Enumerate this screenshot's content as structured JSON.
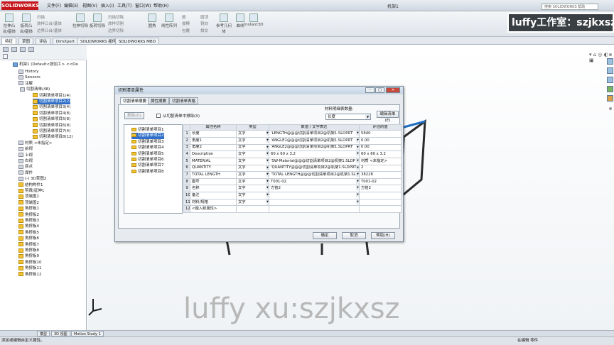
{
  "app": {
    "logo": "SOLIDWORKS",
    "doc_title": "机架1",
    "search_placeholder": "搜索 SOLIDWORKS 帮助"
  },
  "menu": [
    "文件(F)",
    "编辑(E)",
    "视图(V)",
    "插入(I)",
    "工具(T)",
    "窗口(W)",
    "帮助(H)"
  ],
  "ribbon": {
    "buttons": [
      {
        "label": "拉伸凸台/基体"
      },
      {
        "label": "旋转凸台/基体"
      },
      {
        "label": "拉伸切除"
      },
      {
        "label": "旋转切除"
      },
      {
        "label": "圆角"
      },
      {
        "label": "线性阵列"
      },
      {
        "label": "拔模"
      },
      {
        "label": "包覆"
      },
      {
        "label": "参考几何体"
      },
      {
        "label": "曲线"
      },
      {
        "label": "Instant3D"
      }
    ],
    "small_items": [
      "扫描",
      "放样凸台/基体",
      "边界凸台/基体",
      "扫描切除",
      "放样切割",
      "边界切除",
      "筋",
      "圆顶",
      "镜向",
      "相交"
    ]
  },
  "brand_banner": "luffy工作室：szjkxsz",
  "tabs": [
    "特征",
    "草图",
    "评估",
    "DimXpert",
    "SOLIDWORKS 插件",
    "SOLIDWORKS MBD"
  ],
  "tree": {
    "root": "机架1 (Default<按加工> <<De",
    "items": [
      {
        "label": "History",
        "icon": "gray"
      },
      {
        "label": "Sensors",
        "icon": "gray"
      },
      {
        "label": "注解",
        "icon": "gray"
      },
      {
        "label": "切割清单(48)",
        "icon": "gray"
      },
      {
        "label": "切割清单项目1(4)",
        "icon": "yellow"
      },
      {
        "label": "切割清单项目2(2)",
        "icon": "yellow",
        "selected": true
      },
      {
        "label": "切割清单项目3(4)",
        "icon": "yellow"
      },
      {
        "label": "切割清单项目4(8)",
        "icon": "yellow"
      },
      {
        "label": "切割清单项目5(8)",
        "icon": "yellow"
      },
      {
        "label": "切割清单项目6(8)",
        "icon": "yellow"
      },
      {
        "label": "切割清单项目7(4)",
        "icon": "yellow"
      },
      {
        "label": "切割清单项目8(12)",
        "icon": "yellow"
      },
      {
        "label": "材质 <未指定>",
        "icon": "gray"
      },
      {
        "label": "前视",
        "icon": "gray"
      },
      {
        "label": "上视",
        "icon": "gray"
      },
      {
        "label": "右视",
        "icon": "gray"
      },
      {
        "label": "原点",
        "icon": "gray"
      },
      {
        "label": "焊件",
        "icon": "gray"
      },
      {
        "label": "(-) 3D草图2",
        "icon": "gray"
      },
      {
        "label": "结构构件1",
        "icon": "yellow"
      },
      {
        "label": "剪裁/延伸1",
        "icon": "yellow"
      },
      {
        "label": "顶端盖1",
        "icon": "yellow"
      },
      {
        "label": "顶端盖2",
        "icon": "yellow"
      },
      {
        "label": "角撑板1",
        "icon": "yellow"
      },
      {
        "label": "角撑板2",
        "icon": "yellow"
      },
      {
        "label": "角撑板3",
        "icon": "yellow"
      },
      {
        "label": "角撑板4",
        "icon": "yellow"
      },
      {
        "label": "角撑板5",
        "icon": "yellow"
      },
      {
        "label": "角撑板6",
        "icon": "yellow"
      },
      {
        "label": "角撑板7",
        "icon": "yellow"
      },
      {
        "label": "角撑板8",
        "icon": "yellow"
      },
      {
        "label": "角撑板9",
        "icon": "yellow"
      },
      {
        "label": "角撑板10",
        "icon": "yellow"
      },
      {
        "label": "角撑板11",
        "icon": "yellow"
      },
      {
        "label": "角撑板12",
        "icon": "yellow"
      }
    ]
  },
  "dialog": {
    "title": "切割清单属性",
    "tabs": [
      "切割清单摘要",
      "属性摘要",
      "切割清单表格"
    ],
    "delete_button": "删除(D)",
    "exclude_checkbox_label": "从切割清单中排除(X)",
    "length_label": "材料明细表数量:",
    "length_value": "长度",
    "edit_list_button": "编辑清单(E)",
    "items": [
      "切割清单项目1",
      "切割清单项目2",
      "切割清单项目3",
      "切割清单项目4",
      "切割清单项目5",
      "切割清单项目6",
      "切割清单项目7",
      "切割清单项目8"
    ],
    "selected_item_index": 1,
    "table": {
      "headers": [
        "属性名称",
        "类型",
        "数值 / 文字表达",
        "评估的值"
      ],
      "rows": [
        {
          "n": "1",
          "name": "长度",
          "type": "文字",
          "expr": "'LENGTH@@@切割清单项目2@机架1.SLDPRT'",
          "value": "5840"
        },
        {
          "n": "2",
          "name": "角度1",
          "type": "文字",
          "expr": "'ANGLE1@@@切割清单项目2@机架1.SLDPRT'",
          "value": "0.00"
        },
        {
          "n": "3",
          "name": "角度2",
          "type": "文字",
          "expr": "'ANGLE2@@@切割清单项目2@机架1.SLDPRT'",
          "value": "0.00"
        },
        {
          "n": "4",
          "name": "Description",
          "type": "文字",
          "expr": "60 x 60 x 3.2",
          "value": "60 x 60 x 3.2"
        },
        {
          "n": "5",
          "name": "MATERIAL",
          "type": "文字",
          "expr": "'SW-Material@@@切割清单项目2@机架1.SLDP",
          "value": "材质 <未指定>"
        },
        {
          "n": "6",
          "name": "QUANTITY",
          "type": "文字",
          "expr": "'QUANTITY@@@切割清单项目2@机架1.SLDPRT",
          "value": "2"
        },
        {
          "n": "7",
          "name": "TOTAL LENGTH",
          "type": "文字",
          "expr": "'TOTAL LENGTH@@@切割清单项目2@机架1.SL",
          "value": "38228"
        },
        {
          "n": "8",
          "name": "图号",
          "type": "文字",
          "expr": "T001-02",
          "value": "T001-02"
        },
        {
          "n": "9",
          "name": "名称",
          "type": "文字",
          "expr": "方管2",
          "value": "方管2"
        },
        {
          "n": "10",
          "name": "备注",
          "type": "文字",
          "expr": "",
          "value": ""
        },
        {
          "n": "11",
          "name": "材料/规格",
          "type": "文字",
          "expr": "",
          "value": ""
        },
        {
          "n": "12",
          "name": "<键入新属性>",
          "type": "",
          "expr": "",
          "value": ""
        }
      ]
    },
    "ok": "确定",
    "cancel": "取消",
    "help": "帮助(H)"
  },
  "watermark": "luffy xu:szjkxsz",
  "bottom_tabs": [
    "模型",
    "3D 视图",
    "Motion Study 1"
  ],
  "status": {
    "left": "添加或编辑自定义属性。",
    "right": "在编辑 零件"
  }
}
